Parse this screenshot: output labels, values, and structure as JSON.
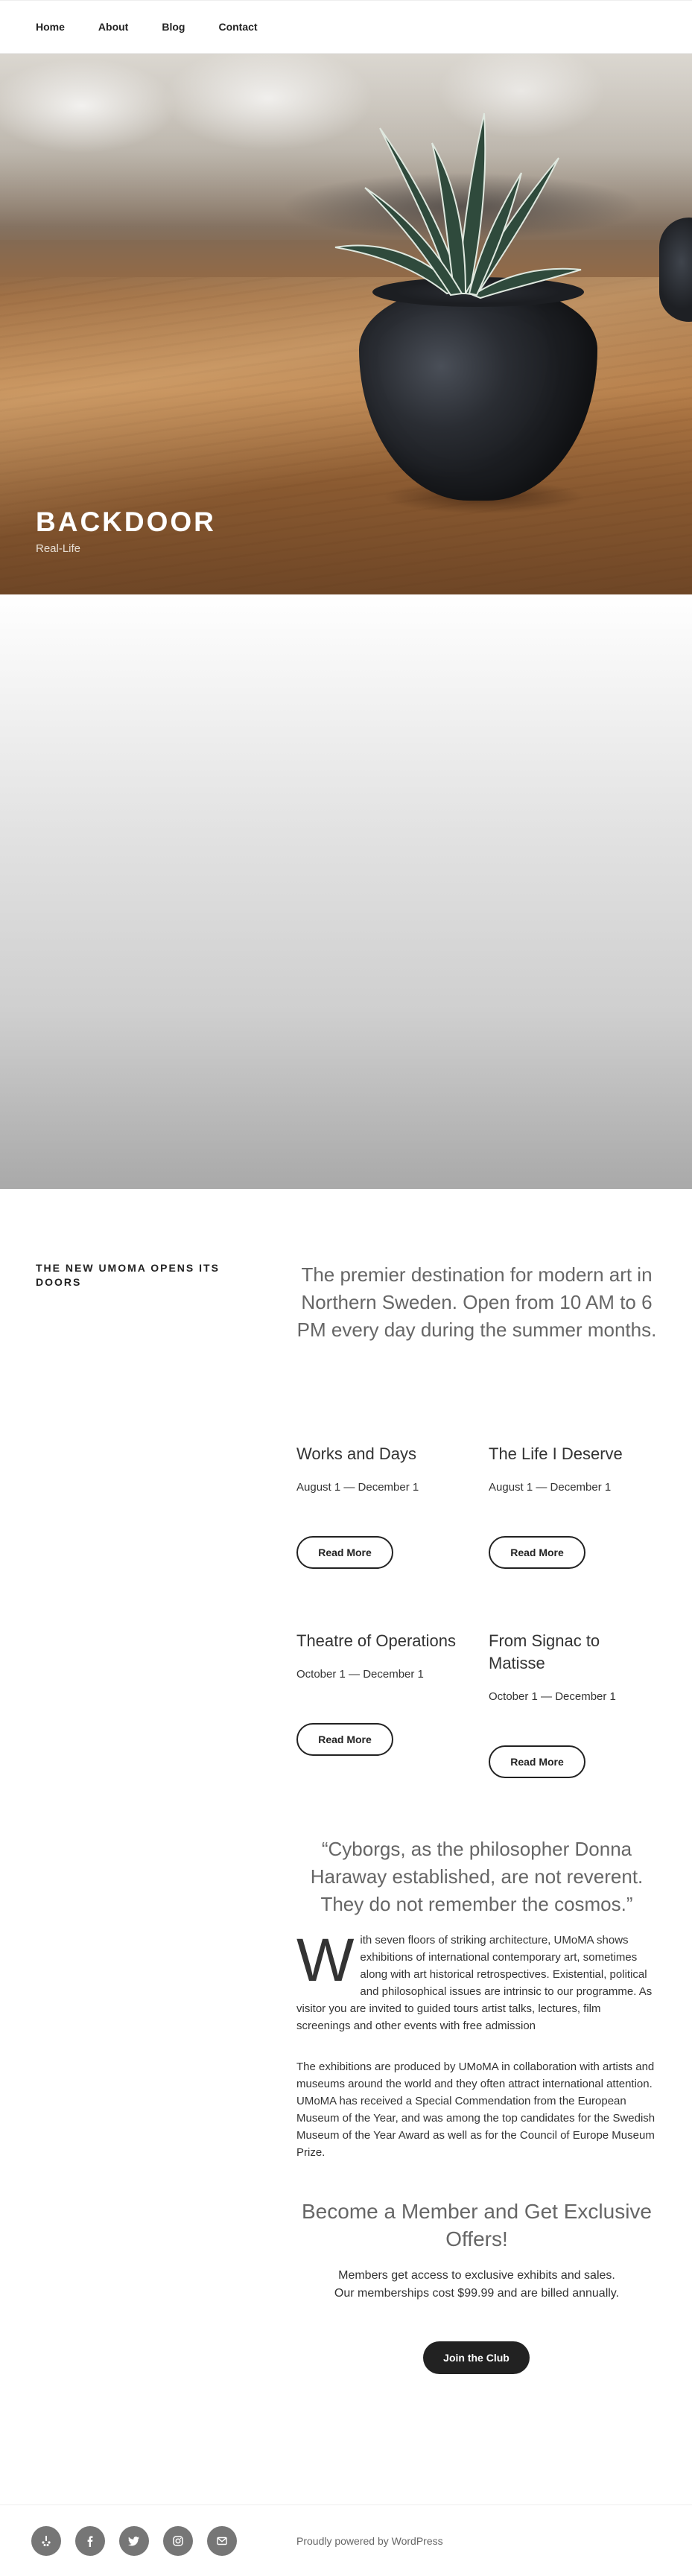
{
  "nav": {
    "items": [
      {
        "label": "Home"
      },
      {
        "label": "About"
      },
      {
        "label": "Blog"
      },
      {
        "label": "Contact"
      }
    ]
  },
  "hero": {
    "title": "BACKDOOR",
    "tagline": "Real-Life"
  },
  "content": {
    "section_title": "THE NEW UMOMA OPENS ITS DOORS",
    "intro": "The premier destination for modern art in Northern Sweden. Open from 10 AM to 6 PM every day during the summer months.",
    "events": [
      {
        "title": "Works and Days",
        "dates": "August 1 — December 1",
        "button": "Read More"
      },
      {
        "title": "The Life I Deserve",
        "dates": "August 1 — December 1",
        "button": "Read More"
      },
      {
        "title": "Theatre of Operations",
        "dates": "October 1 — December 1",
        "button": "Read More"
      },
      {
        "title": "From Signac to Matisse",
        "dates": "October 1 — December 1",
        "button": "Read More"
      }
    ],
    "quote": "“Cyborgs, as the philosopher Donna Haraway established, are not reverent. They do not remember the cosmos.”",
    "para1_dropcap": "W",
    "para1_rest": "ith seven floors of striking architecture, UMoMA shows exhibitions of international contemporary art, sometimes along with art historical retrospectives. Existential, political and philosophical issues are intrinsic to our programme. As visitor you are invited to guided tours artist talks, lectures, film screenings and other events with free admission",
    "para2": "The exhibitions are produced by UMoMA in collaboration with artists and museums around the world and they often attract international attention. UMoMA has received a Special Commendation from the European Museum of the Year, and was among the top candidates for the Swedish Museum of the Year Award as well as for the Council of Europe Museum Prize.",
    "member_title": "Become a Member and Get Exclusive Offers!",
    "member_line1": "Members get access to exclusive exhibits and sales.",
    "member_line2": "Our memberships cost $99.99 and are billed annually.",
    "join_button": "Join the Club"
  },
  "footer": {
    "social_icons": [
      "yelp-icon",
      "facebook-icon",
      "twitter-icon",
      "instagram-icon",
      "email-icon"
    ],
    "powered_by": "Proudly powered by WordPress"
  }
}
